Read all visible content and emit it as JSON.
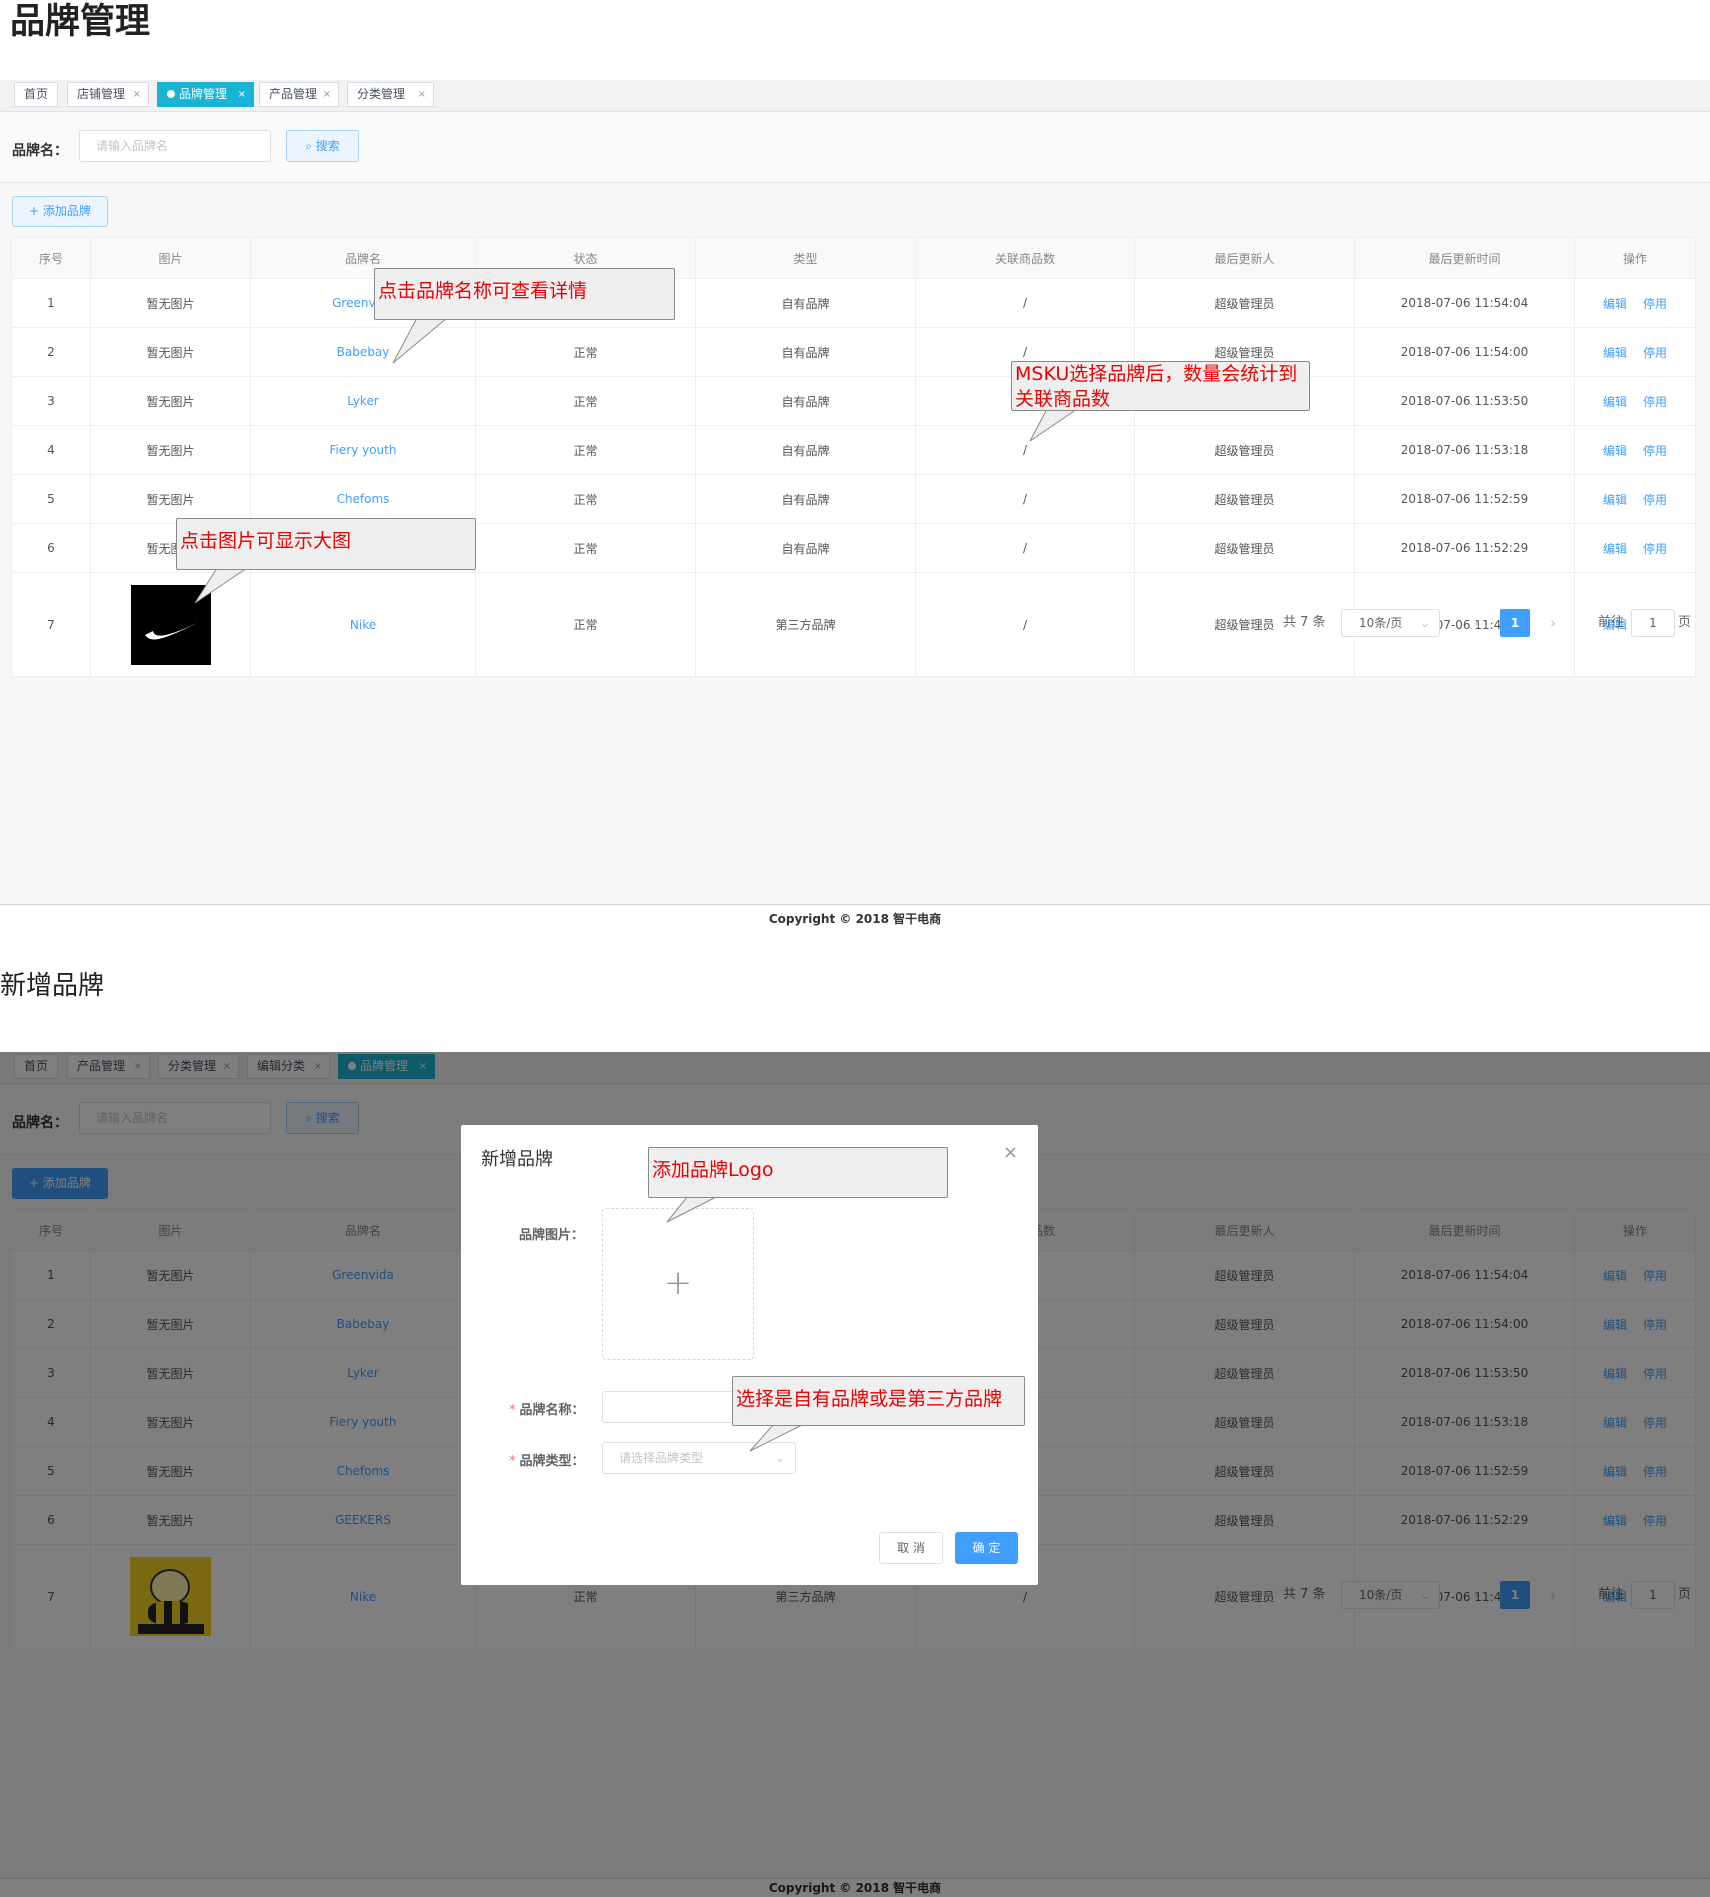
{
  "section1_title": "品牌管理",
  "section2_title": "新增品牌",
  "panel1": {
    "tabs": [
      {
        "label": "首页",
        "closable": false,
        "active": false
      },
      {
        "label": "店铺管理",
        "closable": true,
        "active": false
      },
      {
        "label": "品牌管理",
        "closable": true,
        "active": true
      },
      {
        "label": "产品管理",
        "closable": true,
        "active": false
      },
      {
        "label": "分类管理",
        "closable": true,
        "active": false
      }
    ],
    "brand_rows": [
      {
        "no": "1",
        "pic": "暂无图片",
        "name": "Greenvida",
        "status": "正常",
        "type": "自有品牌",
        "linked": "/",
        "updater": "超级管理员",
        "time": "2018-07-06 11:54:04"
      },
      {
        "no": "2",
        "pic": "暂无图片",
        "name": "Babebay",
        "status": "正常",
        "type": "自有品牌",
        "linked": "/",
        "updater": "超级管理员",
        "time": "2018-07-06 11:54:00"
      },
      {
        "no": "3",
        "pic": "暂无图片",
        "name": "Lyker",
        "status": "正常",
        "type": "自有品牌",
        "linked": "/",
        "updater": "超级管理员",
        "time": "2018-07-06 11:53:50"
      },
      {
        "no": "4",
        "pic": "暂无图片",
        "name": "Fiery youth",
        "status": "正常",
        "type": "自有品牌",
        "linked": "/",
        "updater": "超级管理员",
        "time": "2018-07-06 11:53:18"
      },
      {
        "no": "5",
        "pic": "暂无图片",
        "name": "Chefoms",
        "status": "正常",
        "type": "自有品牌",
        "linked": "/",
        "updater": "超级管理员",
        "time": "2018-07-06 11:52:59"
      },
      {
        "no": "6",
        "pic": "暂无图片",
        "name": "GEEKERS",
        "status": "正常",
        "type": "自有品牌",
        "linked": "/",
        "updater": "超级管理员",
        "time": "2018-07-06 11:52:29"
      },
      {
        "no": "7",
        "pic": "",
        "name": "Nike",
        "status": "正常",
        "type": "第三方品牌",
        "linked": "/",
        "updater": "超级管理员",
        "time": "2018-07-06 11:48:37"
      }
    ],
    "callouts": {
      "name_detail": "点击品牌名称可查看详情",
      "msku": "MSKU选择品牌后，数量会统计到关联商品数",
      "image_big": "点击图片可显示大图"
    }
  },
  "panel2": {
    "tabs": [
      {
        "label": "首页",
        "closable": false,
        "active": false
      },
      {
        "label": "产品管理",
        "closable": true,
        "active": false
      },
      {
        "label": "分类管理",
        "closable": true,
        "active": false
      },
      {
        "label": "编辑分类",
        "closable": true,
        "active": false
      },
      {
        "label": "品牌管理",
        "closable": true,
        "active": true
      }
    ],
    "callouts": {
      "logo": "添加品牌Logo",
      "type": "选择是自有品牌或是第三方品牌"
    }
  },
  "search": {
    "label": "品牌名：",
    "placeholder": "请输入品牌名",
    "button": "搜索"
  },
  "add_button": "添加品牌",
  "columns": [
    "序号",
    "图片",
    "品牌名",
    "状态",
    "类型",
    "关联商品数",
    "最后更新人",
    "最后更新时间",
    "操作"
  ],
  "actions": {
    "edit": "编辑",
    "disable": "停用"
  },
  "pagination": {
    "total": "共 7 条",
    "page_size": "10条/页",
    "current": "1",
    "goto_label": "前往",
    "goto_value": "1",
    "page_unit": "页"
  },
  "footer": "Copyright © 2018 智干电商",
  "modal": {
    "title": "新增品牌",
    "close": "×",
    "image_label": "品牌图片：",
    "name_label": "品牌名称：",
    "type_label": "品牌类型：",
    "type_placeholder": "请选择品牌类型",
    "cancel": "取 消",
    "confirm": "确 定"
  },
  "colors": {
    "accent": "#409eff",
    "active_tab": "#19b4d4",
    "callout_text": "#e00000"
  }
}
